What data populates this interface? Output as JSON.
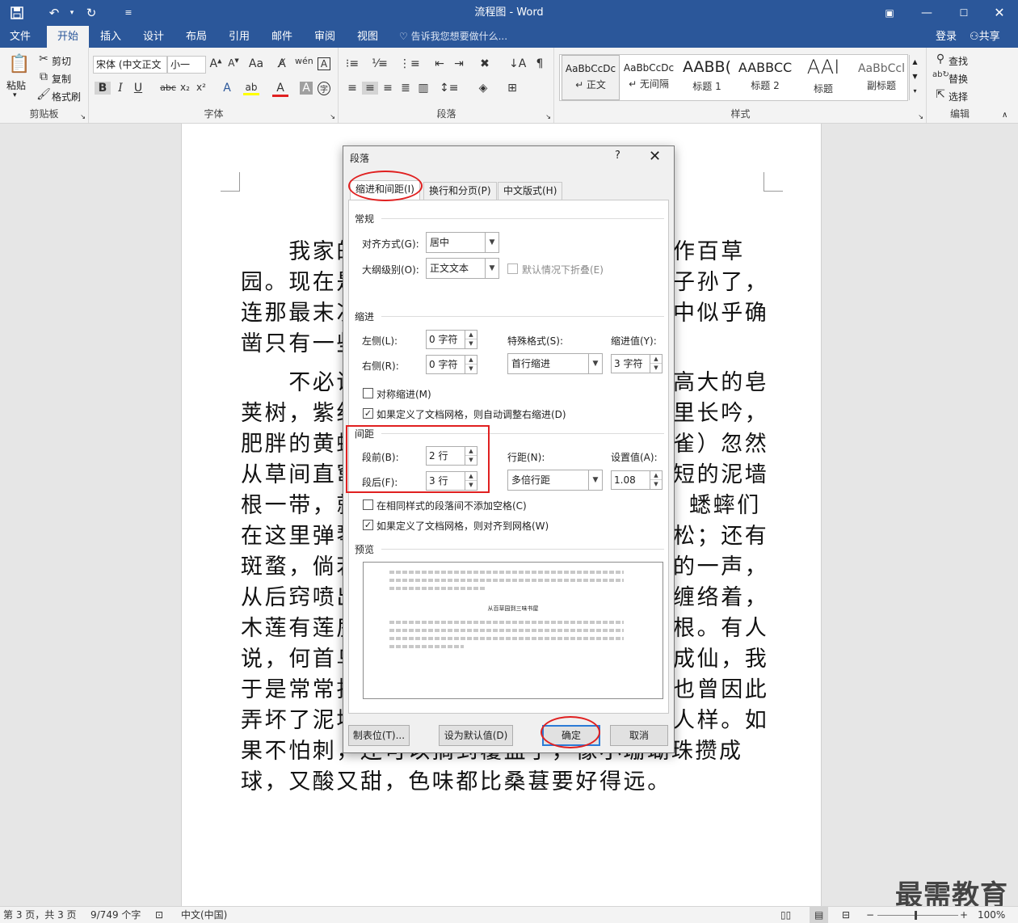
{
  "titlebar": {
    "title": "流程图 - Word",
    "save_icon": "save-icon",
    "undo_icon": "undo-icon",
    "redo_icon": "redo-icon"
  },
  "tabs": [
    "文件",
    "开始",
    "插入",
    "设计",
    "布局",
    "引用",
    "邮件",
    "审阅",
    "视图"
  ],
  "tell_me": "告诉我您想要做什么...",
  "account": {
    "login": "登录",
    "share": "共享"
  },
  "ribbon": {
    "clipboard": {
      "label": "剪贴板",
      "paste": "粘贴",
      "cut": "剪切",
      "copy": "复制",
      "format_painter": "格式刷"
    },
    "font": {
      "label": "字体",
      "font_name": "宋体 (中文正文",
      "font_size": "小一"
    },
    "paragraph": {
      "label": "段落"
    },
    "styles": {
      "label": "样式",
      "items": [
        {
          "sample": "AaBbCcDc",
          "name": "↵ 正文"
        },
        {
          "sample": "AaBbCcDc",
          "name": "↵ 无间隔"
        },
        {
          "sample": "AABB(",
          "name": "标题 1"
        },
        {
          "sample": "AABBCC",
          "name": "标题 2"
        },
        {
          "sample": "AAI",
          "name": "标题"
        },
        {
          "sample": "AaBbCcl",
          "name": "副标题"
        }
      ]
    },
    "editing": {
      "label": "编辑",
      "find": "查找",
      "replace": "替换",
      "select": "选择"
    }
  },
  "document": {
    "lines": [
      "　　我家的",
      "园。现在是",
      "连那最末次",
      "凿只有一些",
      "　　不必说",
      "荚树，紫绀",
      "肥胖的黄蜂",
      "从草间直窜",
      "根一带，就",
      "在这里弹琴",
      "斑蝥，倘若",
      "从后窍喷出",
      "木莲有莲房",
      "说，何首乌",
      "于是常常拔",
      "弄坏了泥墙",
      "果不怕刺，还可以摘到覆盆子，像小珊瑚珠攒成",
      "球，又酸又甜，色味都比桑葚要好得远。"
    ],
    "right_parts": [
      "作百草",
      "子孙了，",
      "中似乎确",
      "",
      "高大的皂",
      "里长吟，",
      "雀）忽然",
      "短的泥墙",
      "蟋蟀们",
      "松；还有",
      "的一声，",
      "缠络着，",
      "根。有人",
      "成仙，我",
      "也曾因此",
      "人样。如"
    ]
  },
  "dialog": {
    "title": "段落",
    "help": "?",
    "close": "✕",
    "tabs": [
      "缩进和间距(I)",
      "换行和分页(P)",
      "中文版式(H)"
    ],
    "general": {
      "label": "常规",
      "alignment_label": "对齐方式(G):",
      "alignment_value": "居中",
      "outline_label": "大纲级别(O):",
      "outline_value": "正文文本",
      "collapse_label": "默认情况下折叠(E)"
    },
    "indent": {
      "label": "缩进",
      "left_label": "左侧(L):",
      "left_value": "0 字符",
      "right_label": "右侧(R):",
      "right_value": "0 字符",
      "special_label": "特殊格式(S):",
      "special_value": "首行缩进",
      "by_label": "缩进值(Y):",
      "by_value": "3 字符",
      "mirror_label": "对称缩进(M)",
      "auto_adjust_label": "如果定义了文档网格，则自动调整右缩进(D)"
    },
    "spacing": {
      "label": "间距",
      "before_label": "段前(B):",
      "before_value": "2 行",
      "after_label": "段后(F):",
      "after_value": "3 行",
      "line_label": "行距(N):",
      "line_value": "多倍行距",
      "at_label": "设置值(A):",
      "at_value": "1.08",
      "no_space_label": "在相同样式的段落间不添加空格(C)",
      "snap_grid_label": "如果定义了文档网格，则对齐到网格(W)"
    },
    "preview": {
      "label": "预览",
      "sample_text": "从百草园到三味书屋"
    },
    "buttons": {
      "tabs": "制表位(T)...",
      "default": "设为默认值(D)",
      "ok": "确定",
      "cancel": "取消"
    }
  },
  "watermark": "最需教育",
  "statusbar": {
    "page": "第 3 页，共 3 页",
    "words": "9/749 个字",
    "language": "中文(中国)",
    "zoom": "100%"
  },
  "colors": {
    "brand": "#2b579a",
    "annotation": "#e02020",
    "ok_border": "#2b7bd6"
  }
}
